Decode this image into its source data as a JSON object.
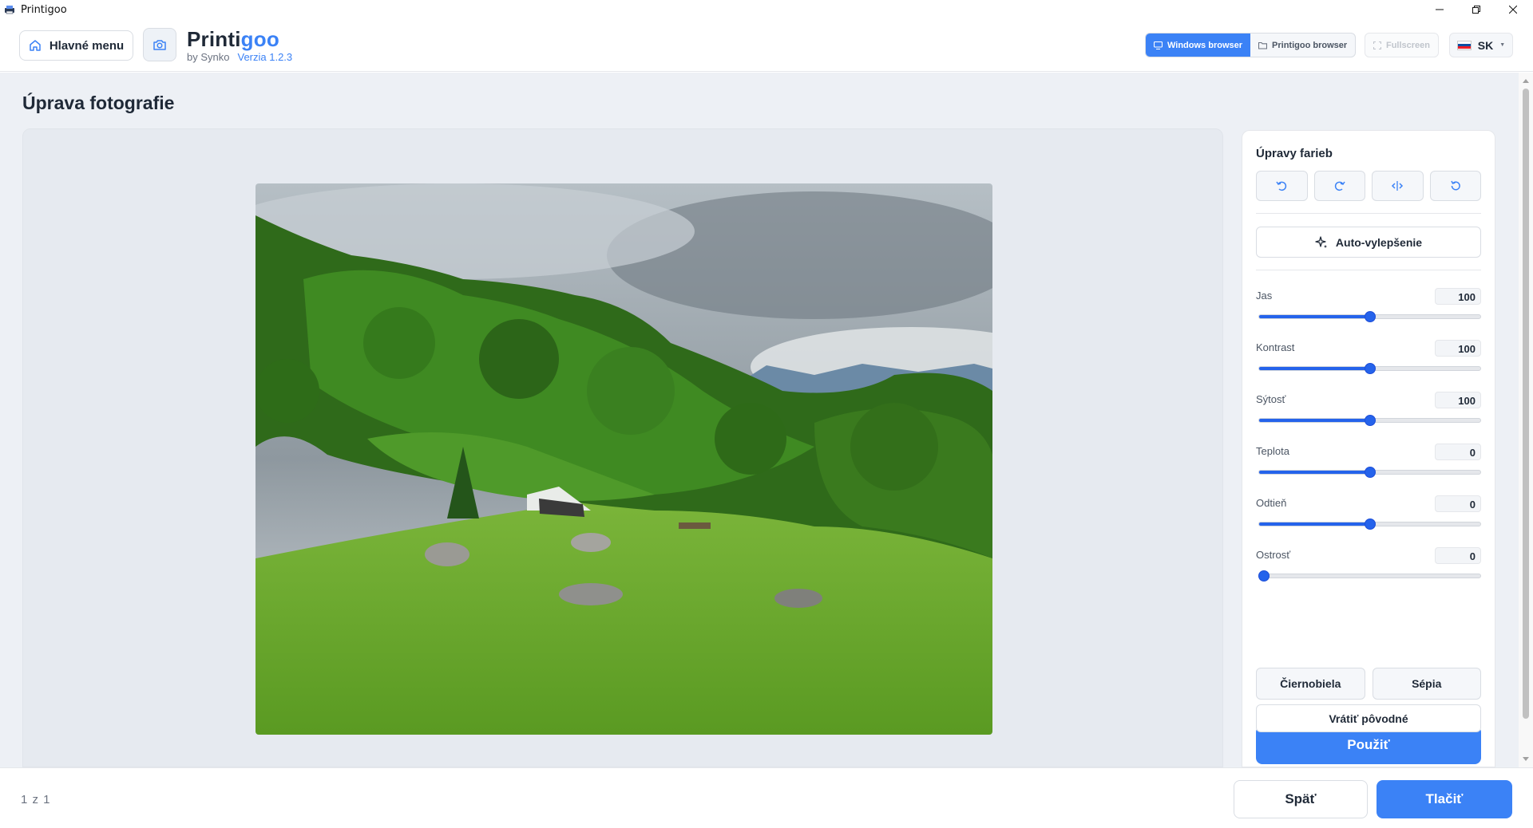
{
  "window": {
    "title": "Printigoo"
  },
  "header": {
    "home_label": "Hlavné menu",
    "brand_prefix": "Printi",
    "brand_accent": "goo",
    "by_label": "by Synko",
    "version_label": "Verzia 1.2.3",
    "view_modes": [
      {
        "label": "Windows browser",
        "icon": "monitor-icon",
        "active": true
      },
      {
        "label": "Printigoo browser",
        "icon": "folder-icon",
        "active": false
      }
    ],
    "fullscreen_label": "Fullscreen",
    "language": "SK"
  },
  "main": {
    "page_title": "Úprava fotografie",
    "image": {
      "description_icon": "landscape-photo"
    }
  },
  "panel": {
    "title": "Úpravy farieb",
    "tools": [
      {
        "icon": "rotate-left-icon"
      },
      {
        "icon": "rotate-right-icon"
      },
      {
        "icon": "flip-horizontal-icon"
      },
      {
        "icon": "reset-icon"
      }
    ],
    "auto_label": "Auto-vylepšenie",
    "sliders": [
      {
        "label": "Jas",
        "value": "100",
        "fraction": 0.5
      },
      {
        "label": "Kontrast",
        "value": "100",
        "fraction": 0.5
      },
      {
        "label": "Sýtosť",
        "value": "100",
        "fraction": 0.5
      },
      {
        "label": "Teplota",
        "value": "0",
        "fraction": 0.5
      },
      {
        "label": "Odtieň",
        "value": "0",
        "fraction": 0.5
      },
      {
        "label": "Ostrosť",
        "value": "0",
        "fraction": 0.0
      }
    ],
    "effects": [
      "Čiernobiela",
      "Sépia"
    ],
    "apply_label": "Použiť",
    "revert_label": "Vrátiť pôvodné"
  },
  "footer": {
    "page_counter": "1 z 1",
    "back_label": "Späť",
    "print_label": "Tlačiť"
  },
  "colors": {
    "accent": "#3b82f6",
    "slider": "#2563eb",
    "background": "#edf0f5"
  }
}
